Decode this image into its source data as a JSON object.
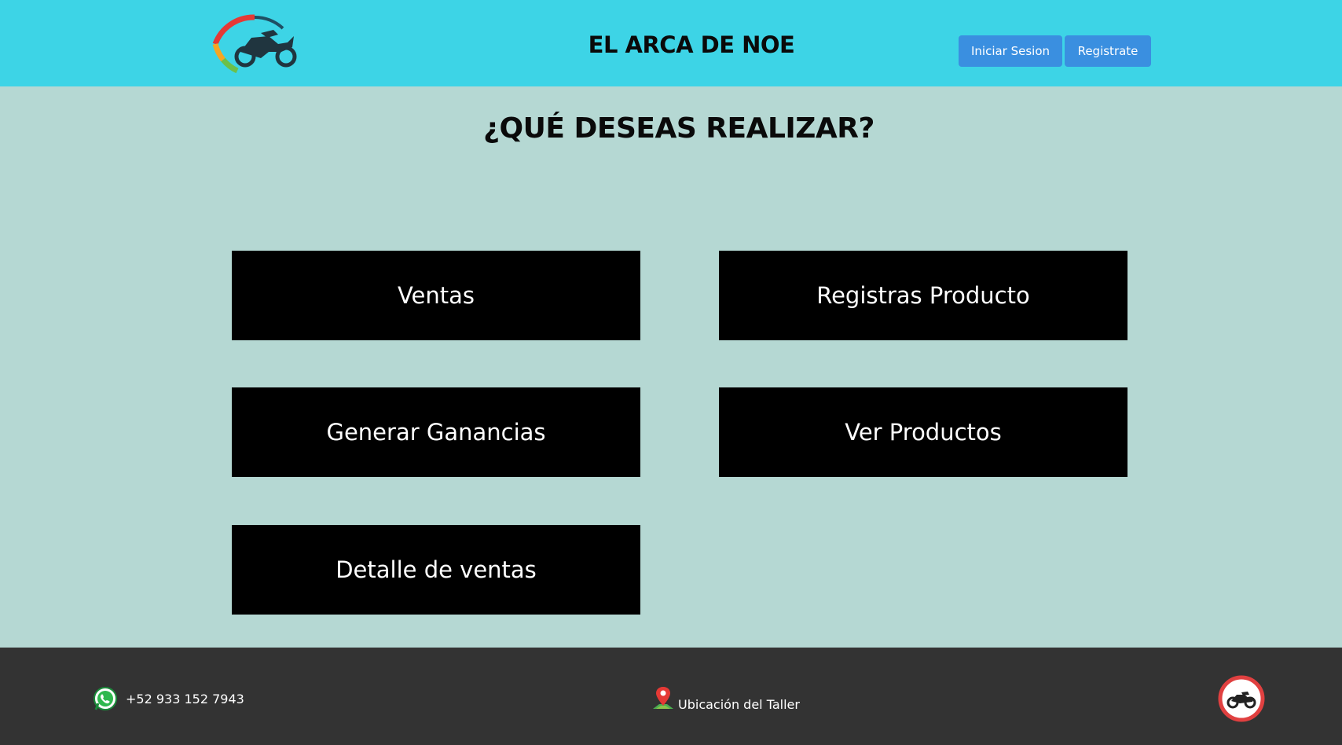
{
  "header": {
    "site_title": "EL ARCA DE NOE",
    "login_label": "Iniciar Sesion",
    "register_label": "Registrate",
    "logo_icon": "motorcycle-speedometer-logo"
  },
  "main": {
    "title": "¿QUÉ DESEAS REALIZAR?",
    "actions": [
      {
        "label": "Ventas"
      },
      {
        "label": "Registras Producto"
      },
      {
        "label": "Generar Ganancias"
      },
      {
        "label": "Ver Productos"
      },
      {
        "label": "Detalle de ventas"
      }
    ]
  },
  "footer": {
    "phone": "+52 933 152 7943",
    "phone_icon": "whatsapp-icon",
    "location_label": "Ubicación del Taller",
    "location_icon": "map-pin-icon",
    "badge_icon": "motorcycle-icon"
  },
  "colors": {
    "header_bg": "#3dd4e6",
    "page_bg": "#b5d8d3",
    "button_bg": "#3a8fe0",
    "action_bg": "#000000",
    "footer_bg": "#333333"
  }
}
